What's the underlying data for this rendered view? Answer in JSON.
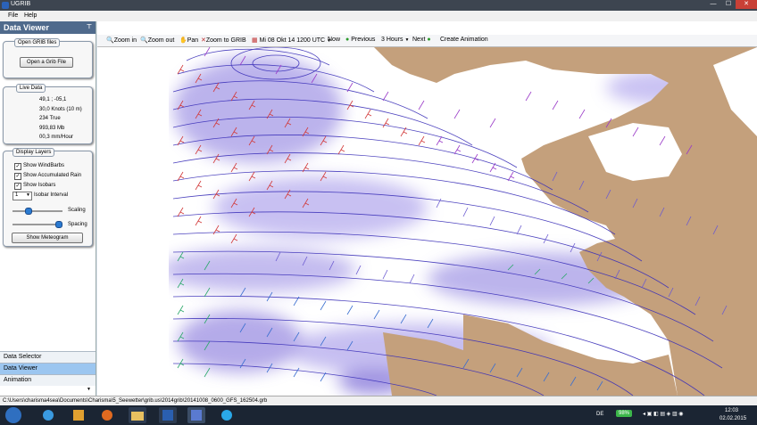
{
  "window": {
    "title": "UGRIB",
    "min": "—",
    "max": "☐",
    "close": "✕"
  },
  "menu": {
    "file": "File",
    "help": "Help"
  },
  "panel": {
    "title": "Data Viewer",
    "pin": "⊤",
    "open_group": {
      "title": "Open GRIB files",
      "button": "Open a Grib File"
    },
    "live_group": {
      "title": "Live Data",
      "position": "49,1 ; -05,1",
      "wind": "30,0 Knots (10 m)",
      "direction": "234 True",
      "pressure": "993,83 Mb",
      "rain": "00,3 mm/Hour"
    },
    "layers_group": {
      "title": "Display Layers",
      "windbarbs": "Show WindBarbs",
      "rain": "Show Accumulated Rain",
      "isobars": "Show Isobars",
      "interval_value": "1",
      "interval_label": "Isobar Interval",
      "scaling_label": "Scaling",
      "scaling_value": 0.3,
      "spacing_label": "Spacing",
      "spacing_value": 0.9,
      "meteogram": "Show Meteogram"
    },
    "nav": {
      "selector": "Data Selector",
      "viewer": "Data Viewer",
      "animation": "Animation"
    }
  },
  "toolbar": {
    "zoom_in": "Zoom in",
    "zoom_out": "Zoom out",
    "pan": "Pan",
    "zoom_grib": "Zoom to GRIB",
    "datetime": "Mi 08 Okt 14 1200 UTC",
    "now": "Now",
    "previous": "Previous",
    "step": "3 Hours",
    "next": "Next",
    "create_animation": "Create Animation"
  },
  "status": {
    "path": "C:\\Users\\charisma4sea\\Documents\\Charisma\\5_Seewetter\\grib.us\\2014grib\\20141008_0600_GFS_162504.grb"
  },
  "taskbar": {
    "lang": "DE",
    "battery": "98%",
    "time": "12:03",
    "date": "02.02.2015"
  },
  "colors": {
    "accent": "#4f6a8c",
    "land": "#c4a07c",
    "sea": "#ffffff",
    "rain": "#7c70d8",
    "isobar": "#3a2fb8"
  }
}
